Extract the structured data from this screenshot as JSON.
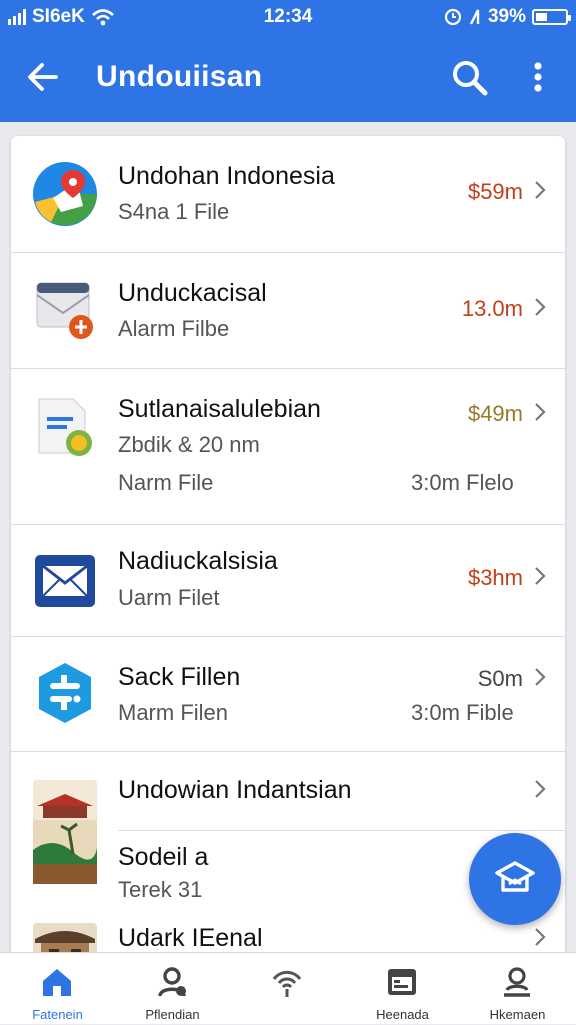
{
  "status_bar": {
    "carrier": "SI6eK",
    "time": "12:34",
    "battery": "39%",
    "battery_level": 0.39
  },
  "header": {
    "title": "Undouiisan"
  },
  "items": [
    {
      "name": "Undohan Indonesia",
      "sub": "S4na 1 File",
      "amount": "$59m",
      "amount_color": "#c1401a",
      "icon": "google-maps-icon"
    },
    {
      "name": "Unduckacisal",
      "sub": "Alarm Filbe",
      "amount": "13.0m",
      "amount_color": "#c1401a",
      "icon": "mail-app-icon"
    },
    {
      "name": "Sutlanaisalulebian",
      "sub": "Zbdik & 20 nm",
      "sub2_left": "Narm File",
      "sub2_right": "3:0m Flelo",
      "amount": "$49m",
      "amount_color": "#9a7a2a",
      "icon": "document-icon"
    },
    {
      "name": "Nadiuckalsisia",
      "sub": "Uarm Filet",
      "amount": "$3hm",
      "amount_color": "#c1401a",
      "icon": "envelope-icon"
    },
    {
      "name": "Sack Fillen",
      "sub": "Marm Filen",
      "sub_right": "3:0m Fible",
      "amount": "S0m",
      "amount_color": "#444444",
      "icon": "chat-bot-icon"
    },
    {
      "name": "Undowian Indantsian",
      "icon": "landscape-photo-icon"
    },
    {
      "name": "Sodeil a",
      "sub": "Terek 31"
    },
    {
      "name": "Udark IEenal",
      "icon": "building-photo-icon"
    }
  ],
  "nav": [
    {
      "label": "Fatenein",
      "icon": "home-icon",
      "active": true
    },
    {
      "label": "Pflendian",
      "icon": "person-icon"
    },
    {
      "label": "",
      "icon": "wireless-icon"
    },
    {
      "label": "Heenada",
      "icon": "calendar-icon"
    },
    {
      "label": "Hkemaen",
      "icon": "account-icon"
    }
  ],
  "colors": {
    "primary": "#2f74e4",
    "background": "#e9eaee",
    "amount_red": "#c1401a",
    "amount_gold": "#9a7a2a"
  }
}
